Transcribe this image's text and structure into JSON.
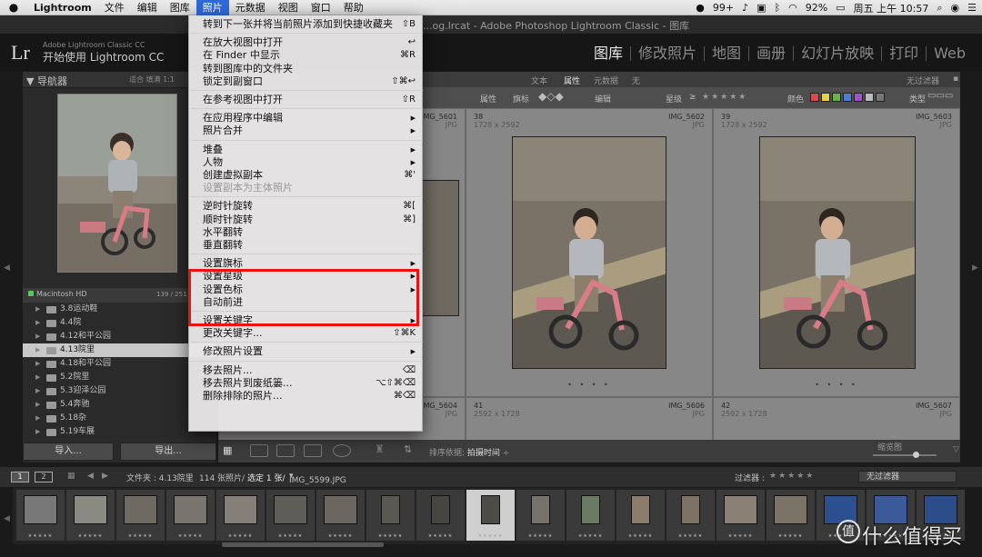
{
  "menubar": {
    "apple_icon": "apple-logo",
    "items": [
      "Lightroom",
      "文件",
      "编辑",
      "图库",
      "照片",
      "元数据",
      "视图",
      "窗口",
      "帮助"
    ],
    "active_index": 4,
    "status": {
      "wechat_badge": "99+",
      "battery": "92%",
      "clock": "周五 上午 10:57"
    }
  },
  "window": {
    "title": "...og.lrcat - Adobe Photoshop Lightroom Classic - 图库"
  },
  "identity": {
    "logo": "Lr",
    "brand_small": "Adobe Lightroom Classic CC",
    "brand_large": "开始使用 Lightroom CC"
  },
  "modules": [
    "图库",
    "修改照片",
    "地图",
    "画册",
    "幻灯片放映",
    "打印",
    "Web"
  ],
  "navigator": {
    "title": "导航器",
    "options": "适合   填满   1:1"
  },
  "catalog": {
    "disk_label": "Macintosh HD",
    "disk_count": "139 / 251 GB",
    "folders": [
      {
        "name": "3.8运动鞋",
        "selected": false
      },
      {
        "name": "4.4院",
        "selected": false
      },
      {
        "name": "4.12和平公园",
        "selected": false
      },
      {
        "name": "4.13院里",
        "selected": true
      },
      {
        "name": "4.18和平公园",
        "selected": false
      },
      {
        "name": "5.2院里",
        "selected": false
      },
      {
        "name": "5.3迎泽公园",
        "selected": false
      },
      {
        "name": "5.4奔驰",
        "selected": false
      },
      {
        "name": "5.18杂",
        "selected": false
      },
      {
        "name": "5.19车展",
        "selected": false
      }
    ],
    "folder_last_count": "133"
  },
  "left_buttons": {
    "import": "导入...",
    "export": "导出..."
  },
  "filterbar": {
    "items": [
      "文本",
      "属性",
      "元数据",
      "无"
    ],
    "active": "属性",
    "preset": "无过滤器"
  },
  "attributes": {
    "label": "属性",
    "flag": "旗标",
    "edit": "编辑",
    "rating": "星级",
    "rating_op": "≥",
    "rating_stars": "★★★★★",
    "color": "颜色",
    "type": "类型",
    "colors": [
      "#d84b4b",
      "#e3d24a",
      "#67b04e",
      "#4f7fd0",
      "#9a57c4",
      "#bbbbbb",
      "#777777"
    ]
  },
  "grid": {
    "cells": [
      {
        "num": "",
        "dim": "",
        "name": "IMG_5601",
        "ext": "JPG"
      },
      {
        "num": "38",
        "dim": "1728 x 2592",
        "name": "IMG_5602",
        "ext": "JPG"
      },
      {
        "num": "39",
        "dim": "1728 x 2592",
        "name": "IMG_5603",
        "ext": "JPG"
      },
      {
        "num": "",
        "dim": "",
        "name": "IMG_5604",
        "ext": "JPG"
      },
      {
        "num": "41",
        "dim": "2592 x 1728",
        "name": "IMG_5606",
        "ext": "JPG"
      },
      {
        "num": "42",
        "dim": "2592 x 1728",
        "name": "IMG_5607",
        "ext": "JPG"
      }
    ],
    "dots": "• • • •"
  },
  "toolbar": {
    "sort_label": "排序依据:",
    "sort_value": "拍摄时间",
    "thumbnails_label": "缩览图",
    "icons": [
      "grid-view-icon",
      "loupe-view-icon",
      "compare-view-icon",
      "survey-view-icon",
      "people-view-icon",
      "painter-icon",
      "sort-direction-icon"
    ]
  },
  "filmstrip_header": {
    "pages": [
      "1",
      "2"
    ],
    "source": "文件夹 : 4.13院里",
    "count": "114 张照片/",
    "selected": "选定 1 张/",
    "file": "IMG_5599.JPG",
    "filter_label": "过滤器 :",
    "filter_stars": "★★★★★",
    "filter_value": "无过滤器"
  },
  "filmstrip": {
    "count": 19,
    "selected_index": 9,
    "star_text": "★★★★★"
  },
  "watermark": {
    "circle": "值",
    "text": "什么值得买"
  },
  "photo_menu": {
    "items": [
      {
        "label": "转到下一张并将当前照片添加到快捷收藏夹",
        "shortcut": "⇧B",
        "disabled": false,
        "arrow": false
      },
      {
        "sep": true
      },
      {
        "label": "在放大视图中打开",
        "shortcut": "↩",
        "disabled": false,
        "arrow": false
      },
      {
        "label": "在 Finder 中显示",
        "shortcut": "⌘R",
        "disabled": false,
        "arrow": false
      },
      {
        "label": "转到图库中的文件夹",
        "shortcut": "",
        "disabled": false,
        "arrow": false
      },
      {
        "label": "锁定到副窗口",
        "shortcut": "⇧⌘↩",
        "disabled": false,
        "arrow": false
      },
      {
        "sep": true
      },
      {
        "label": "在参考视图中打开",
        "shortcut": "⇧R",
        "disabled": false,
        "arrow": false
      },
      {
        "sep": true
      },
      {
        "label": "在应用程序中编辑",
        "shortcut": "▶",
        "disabled": false,
        "arrow": true
      },
      {
        "label": "照片合并",
        "shortcut": "▶",
        "disabled": false,
        "arrow": true
      },
      {
        "sep": true
      },
      {
        "label": "堆叠",
        "shortcut": "▶",
        "disabled": false,
        "arrow": true
      },
      {
        "label": "人物",
        "shortcut": "▶",
        "disabled": false,
        "arrow": true
      },
      {
        "label": "创建虚拟副本",
        "shortcut": "⌘'",
        "disabled": false,
        "arrow": false
      },
      {
        "label": "设置副本为主体照片",
        "shortcut": "",
        "disabled": true,
        "arrow": false
      },
      {
        "sep": true
      },
      {
        "label": "逆时针旋转",
        "shortcut": "⌘[",
        "disabled": false,
        "arrow": false
      },
      {
        "label": "顺时针旋转",
        "shortcut": "⌘]",
        "disabled": false,
        "arrow": false
      },
      {
        "label": "水平翻转",
        "shortcut": "",
        "disabled": false,
        "arrow": false
      },
      {
        "label": "垂直翻转",
        "shortcut": "",
        "disabled": false,
        "arrow": false
      },
      {
        "sep": true
      },
      {
        "label": "设置旗标",
        "shortcut": "▶",
        "disabled": false,
        "arrow": true
      },
      {
        "label": "设置星级",
        "shortcut": "▶",
        "disabled": false,
        "arrow": true
      },
      {
        "label": "设置色标",
        "shortcut": "▶",
        "disabled": false,
        "arrow": true
      },
      {
        "label": "自动前进",
        "shortcut": "",
        "disabled": false,
        "arrow": false
      },
      {
        "sep": true
      },
      {
        "label": "设置关键字",
        "shortcut": "▶",
        "disabled": false,
        "arrow": true
      },
      {
        "label": "更改关键字...",
        "shortcut": "⇧⌘K",
        "disabled": false,
        "arrow": false
      },
      {
        "sep": true
      },
      {
        "label": "修改照片设置",
        "shortcut": "▶",
        "disabled": false,
        "arrow": true
      },
      {
        "sep": true
      },
      {
        "label": "移去照片...",
        "shortcut": "⌫",
        "disabled": false,
        "arrow": false
      },
      {
        "label": "移去照片到废纸篓...",
        "shortcut": "⌥⇧⌘⌫",
        "disabled": false,
        "arrow": false
      },
      {
        "label": "删除排除的照片...",
        "shortcut": "⌘⌫",
        "disabled": false,
        "arrow": false
      }
    ]
  }
}
